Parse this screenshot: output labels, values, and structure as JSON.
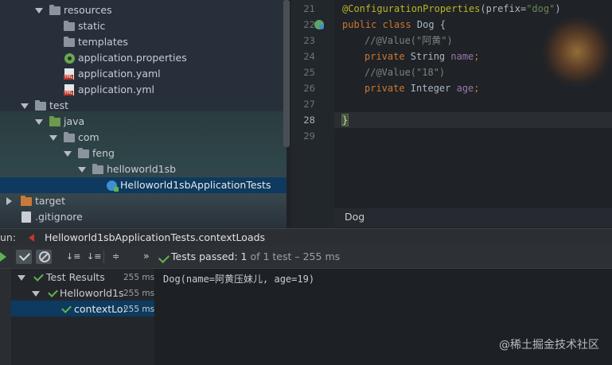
{
  "tree": {
    "resources": "resources",
    "static": "static",
    "templates": "templates",
    "application_properties": "application.properties",
    "application_yaml": "application.yaml",
    "application_yml": "application.yml",
    "test": "test",
    "java": "java",
    "com": "com",
    "feng": "feng",
    "helloworld1sb": "helloworld1sb",
    "test_class": "Helloworld1sbApplicationTests",
    "target": "target",
    "gitignore": ".gitignore"
  },
  "editor": {
    "lines": [
      {
        "n": "21"
      },
      {
        "n": "22"
      },
      {
        "n": "23"
      },
      {
        "n": "24"
      },
      {
        "n": "25"
      },
      {
        "n": "26"
      },
      {
        "n": "27"
      },
      {
        "n": "28"
      },
      {
        "n": "29"
      }
    ],
    "code": {
      "l21_ann": "@ConfigurationProperties",
      "l21_p1": "(prefix=",
      "l21_str": "\"dog\"",
      "l21_p2": ")",
      "l22_kw": "public class ",
      "l22_name": "Dog {",
      "l23": "//@Value(\"阿黄\")",
      "l24_kw": "private ",
      "l24_type": "String ",
      "l24_field": "name",
      "l24_end": ";",
      "l25": "//@Value(\"18\")",
      "l26_kw": "private ",
      "l26_type": "Integer ",
      "l26_field": "age",
      "l26_end": ";",
      "l28": "}"
    },
    "tooltip": "Dog"
  },
  "run": {
    "label": "un:",
    "config": "Helloworld1sbApplicationTests.contextLoads",
    "status_prefix": "Tests passed: ",
    "status_count": "1",
    "status_suffix": " of 1 test – 255 ms",
    "more": "»"
  },
  "results": {
    "root_label": "Test Results",
    "root_time": "255 ms",
    "class_label": "Helloworld1s",
    "class_time": "255 ms",
    "method_label": "contextLo:",
    "method_time": "255 ms",
    "output": "Dog(name=阿黄压妹儿, age=19)"
  },
  "watermark": "@稀土掘金技术社区",
  "colors": {
    "pass_green": "#5fb24f",
    "keyword": "#cc7832",
    "annotation": "#bbb529",
    "string": "#6a8759",
    "field": "#9876aa"
  }
}
